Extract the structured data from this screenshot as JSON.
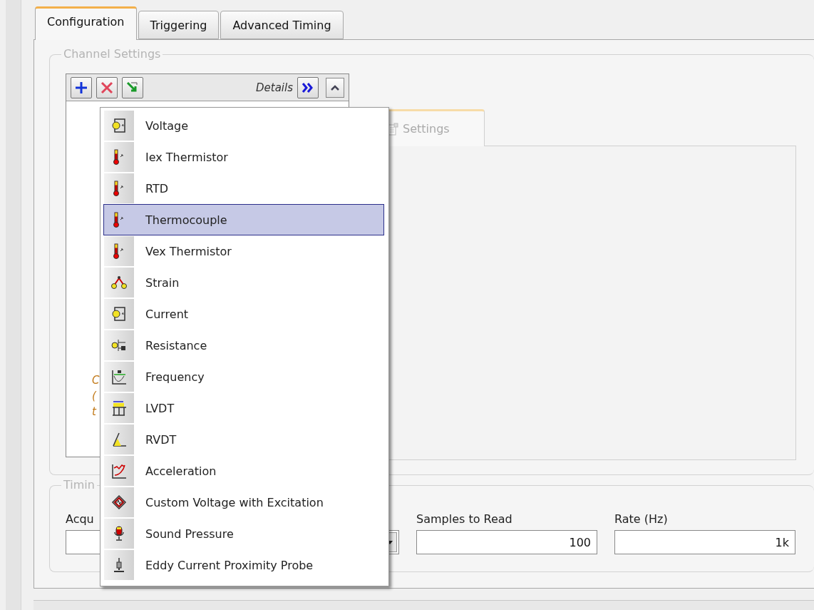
{
  "tabs": [
    {
      "label": "Configuration",
      "selected": true
    },
    {
      "label": "Triggering",
      "selected": false
    },
    {
      "label": "Advanced Timing",
      "selected": false
    }
  ],
  "channel_settings": {
    "title": "Channel Settings",
    "details": "Details",
    "list_fragments": [
      "C",
      "(",
      "t"
    ],
    "settings_tab": "Settings"
  },
  "timing": {
    "title": "Timin",
    "acquisition_label": "Acqu",
    "samples_label": "Samples to Read",
    "samples_value": "100",
    "rate_label": "Rate (Hz)",
    "rate_value": "1k"
  },
  "menu": {
    "items": [
      {
        "label": "Voltage",
        "kind": "meter",
        "selected": false
      },
      {
        "label": "Iex Thermistor",
        "kind": "thermometer",
        "selected": false
      },
      {
        "label": "RTD",
        "kind": "thermometer",
        "selected": false
      },
      {
        "label": "Thermocouple",
        "kind": "thermometer",
        "selected": true
      },
      {
        "label": "Vex Thermistor",
        "kind": "thermometer",
        "selected": false
      },
      {
        "label": "Strain",
        "kind": "strain",
        "selected": false
      },
      {
        "label": "Current",
        "kind": "meter",
        "selected": false
      },
      {
        "label": "Resistance",
        "kind": "resistor",
        "selected": false
      },
      {
        "label": "Frequency",
        "kind": "wave",
        "selected": false
      },
      {
        "label": "LVDT",
        "kind": "lvdt",
        "selected": false
      },
      {
        "label": "RVDT",
        "kind": "angle",
        "selected": false
      },
      {
        "label": "Acceleration",
        "kind": "accel",
        "selected": false
      },
      {
        "label": "Custom Voltage with Excitation",
        "kind": "excitation",
        "selected": false
      },
      {
        "label": "Sound Pressure",
        "kind": "microphone",
        "selected": false
      },
      {
        "label": "Eddy Current Proximity Probe",
        "kind": "probe",
        "selected": false
      }
    ]
  }
}
